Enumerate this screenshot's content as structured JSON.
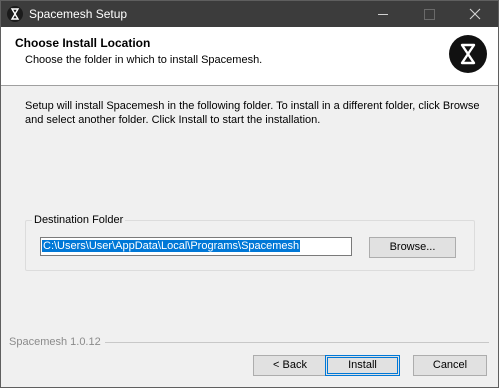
{
  "window": {
    "title": "Spacemesh Setup"
  },
  "header": {
    "title": "Choose Install Location",
    "subtitle": "Choose the folder in which to install Spacemesh."
  },
  "body": {
    "description": "Setup will install Spacemesh in the following folder. To install in a different folder, click Browse and select another folder. Click Install to start the installation."
  },
  "destination": {
    "group_label": "Destination Folder",
    "path_value": "C:\\Users\\User\\AppData\\Local\\Programs\\Spacemesh",
    "browse_label": "Browse..."
  },
  "footer": {
    "brand": "Spacemesh 1.0.12",
    "back_label": "< Back",
    "install_label": "Install",
    "cancel_label": "Cancel"
  },
  "icons": {
    "app": "spacemesh-logo-icon",
    "minimize": "minimize-icon",
    "maximize": "maximize-icon",
    "close": "close-icon"
  }
}
